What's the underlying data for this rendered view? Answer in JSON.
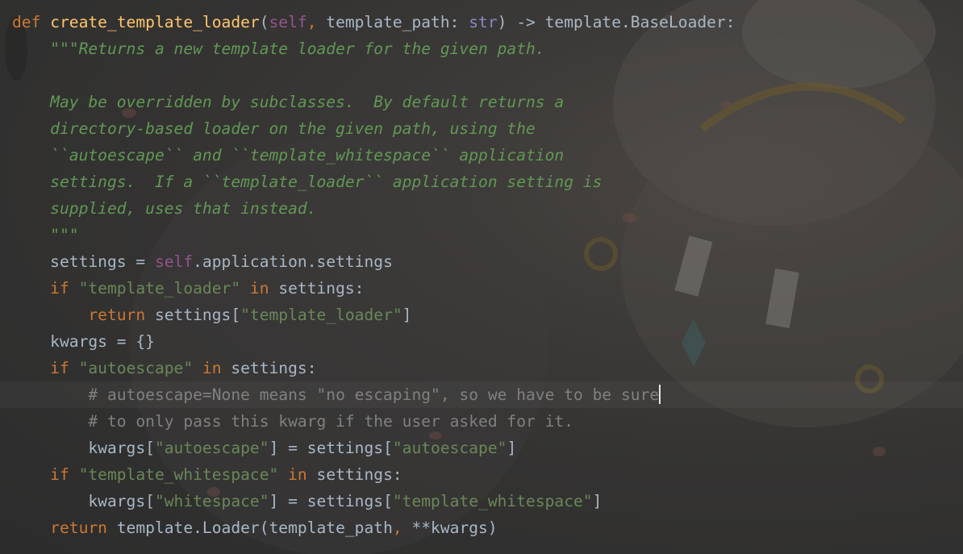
{
  "editor": {
    "language": "python",
    "colors": {
      "keyword": "#cc7832",
      "function": "#ffc66d",
      "self": "#94558d",
      "builtin": "#8888c6",
      "string": "#6a8759",
      "docstring": "#629755",
      "comment": "#808080",
      "text": "#a9b7c6"
    },
    "lines": [
      [
        {
          "t": "kw",
          "v": "def "
        },
        {
          "t": "fn",
          "v": "create_template_loader"
        },
        {
          "t": "plain",
          "v": "("
        },
        {
          "t": "self",
          "v": "self"
        },
        {
          "t": "kw",
          "v": ","
        },
        {
          "t": "plain",
          "v": " template_path: "
        },
        {
          "t": "builtin",
          "v": "str"
        },
        {
          "t": "plain",
          "v": ") -> template.BaseLoader:"
        }
      ],
      [
        {
          "t": "doc",
          "v": "    \"\"\"Returns a new template loader for the given path."
        }
      ],
      [
        {
          "t": "doc",
          "v": ""
        }
      ],
      [
        {
          "t": "doc",
          "v": "    May be overridden by subclasses.  By default returns a"
        }
      ],
      [
        {
          "t": "doc",
          "v": "    directory-based loader on the given path, using the"
        }
      ],
      [
        {
          "t": "doc",
          "v": "    ``autoescape`` and ``template_whitespace`` application"
        }
      ],
      [
        {
          "t": "doc",
          "v": "    settings.  If a ``template_loader`` application setting is"
        }
      ],
      [
        {
          "t": "doc",
          "v": "    supplied, uses that instead."
        }
      ],
      [
        {
          "t": "doc",
          "v": "    \"\"\""
        }
      ],
      [
        {
          "t": "plain",
          "v": "    settings = "
        },
        {
          "t": "self",
          "v": "self"
        },
        {
          "t": "plain",
          "v": ".application.settings"
        }
      ],
      [
        {
          "t": "kw",
          "v": "    if "
        },
        {
          "t": "str",
          "v": "\"template_loader\""
        },
        {
          "t": "kw",
          "v": " in "
        },
        {
          "t": "plain",
          "v": "settings:"
        }
      ],
      [
        {
          "t": "kw",
          "v": "        return "
        },
        {
          "t": "plain",
          "v": "settings["
        },
        {
          "t": "str",
          "v": "\"template_loader\""
        },
        {
          "t": "plain",
          "v": "]"
        }
      ],
      [
        {
          "t": "plain",
          "v": "    kwargs = {}"
        }
      ],
      [
        {
          "t": "kw",
          "v": "    if "
        },
        {
          "t": "str",
          "v": "\"autoescape\""
        },
        {
          "t": "kw",
          "v": " in "
        },
        {
          "t": "plain",
          "v": "settings:"
        }
      ],
      [
        {
          "t": "cmt",
          "v": "        # autoescape=None means \"no escaping\", so we have to be sure"
        },
        {
          "t": "caret",
          "v": ""
        }
      ],
      [
        {
          "t": "cmt",
          "v": "        # to only pass this kwarg if the user asked for it."
        }
      ],
      [
        {
          "t": "plain",
          "v": "        kwargs["
        },
        {
          "t": "str",
          "v": "\"autoescape\""
        },
        {
          "t": "plain",
          "v": "] = settings["
        },
        {
          "t": "str",
          "v": "\"autoescape\""
        },
        {
          "t": "plain",
          "v": "]"
        }
      ],
      [
        {
          "t": "kw",
          "v": "    if "
        },
        {
          "t": "str",
          "v": "\"template_whitespace\""
        },
        {
          "t": "kw",
          "v": " in "
        },
        {
          "t": "plain",
          "v": "settings:"
        }
      ],
      [
        {
          "t": "plain",
          "v": "        kwargs["
        },
        {
          "t": "str",
          "v": "\"whitespace\""
        },
        {
          "t": "plain",
          "v": "] = settings["
        },
        {
          "t": "str",
          "v": "\"template_whitespace\""
        },
        {
          "t": "plain",
          "v": "]"
        }
      ],
      [
        {
          "t": "kw",
          "v": "    return "
        },
        {
          "t": "plain",
          "v": "template.Loader(template_path"
        },
        {
          "t": "kw",
          "v": ","
        },
        {
          "t": "plain",
          "v": " **kwargs)"
        }
      ]
    ],
    "caret_line": 14
  }
}
